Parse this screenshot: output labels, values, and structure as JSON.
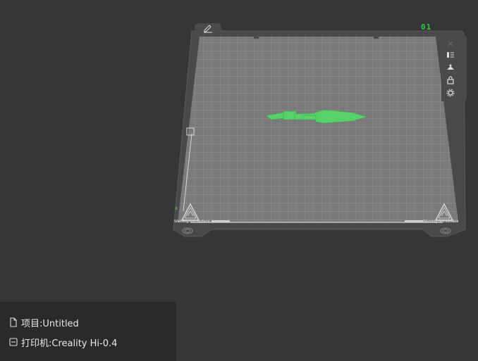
{
  "plate": {
    "index_label": "01",
    "index_color": "#2ecc40",
    "warning_left": "Warning hot surface",
    "warning_right": "Warning hot surface",
    "model_color": "#57d16a"
  },
  "toolbar": {
    "icons": [
      "close-icon",
      "list-icon",
      "auto-arrange-icon",
      "lock-icon",
      "settings-icon"
    ]
  },
  "project": {
    "label": "项目:Untitled",
    "printer_label": "打印机:Creality Hi-0.4"
  }
}
